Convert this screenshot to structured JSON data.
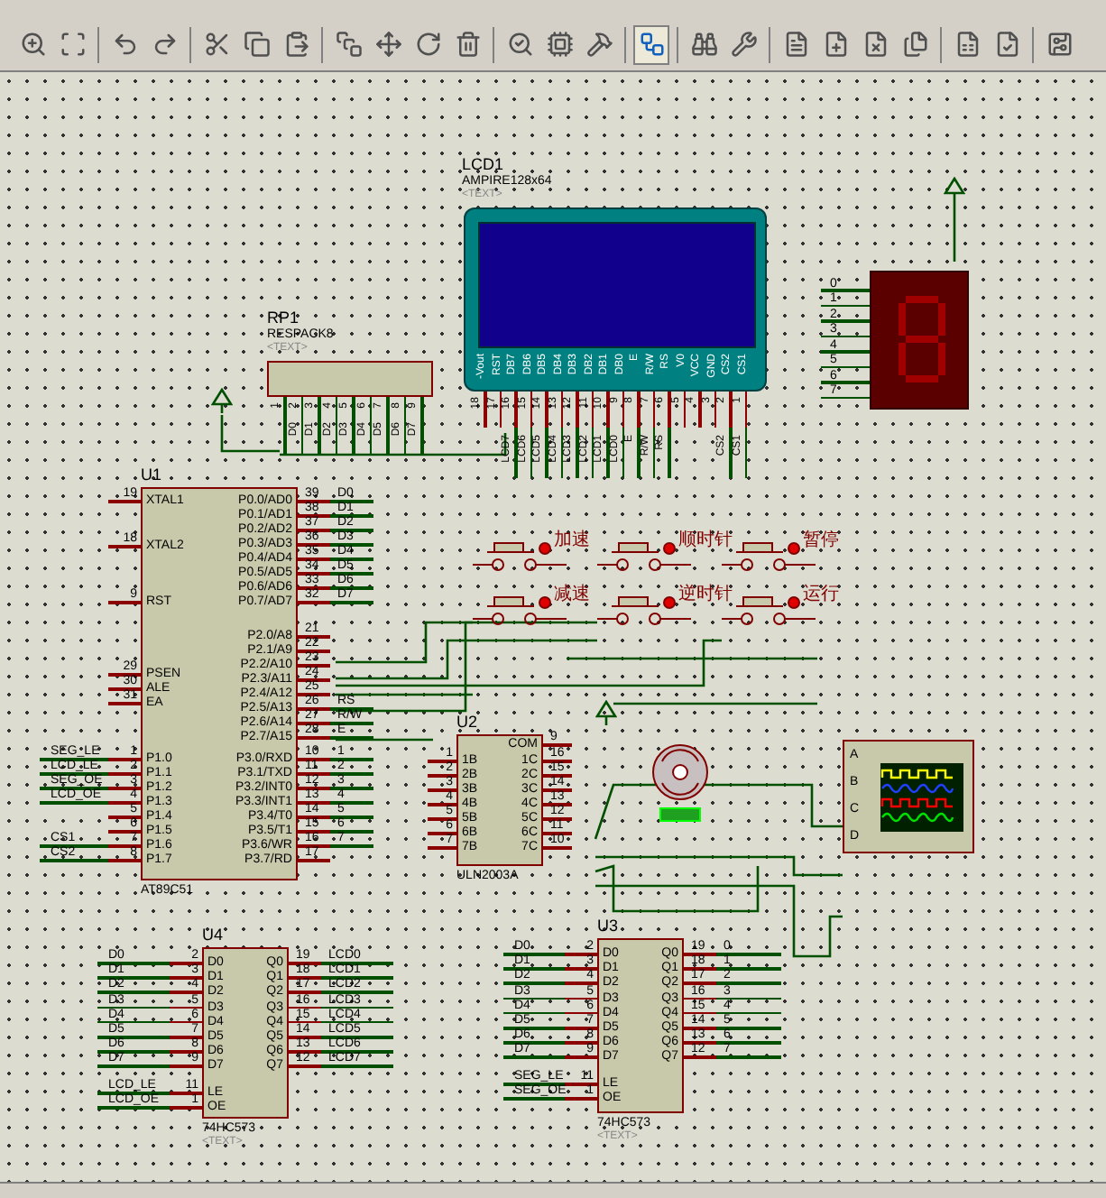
{
  "toolbar": {
    "tools": [
      {
        "kind": "zoom-in",
        "selected": false
      },
      {
        "kind": "zoom-area",
        "selected": false
      },
      {
        "kind": "undo",
        "selected": false
      },
      {
        "kind": "redo",
        "selected": false
      },
      {
        "kind": "cut",
        "selected": false
      },
      {
        "kind": "copy",
        "selected": false
      },
      {
        "kind": "paste",
        "selected": false
      },
      {
        "kind": "block-copy",
        "selected": false
      },
      {
        "kind": "block-move",
        "selected": false
      },
      {
        "kind": "block-rotate",
        "selected": false
      },
      {
        "kind": "block-delete",
        "selected": false
      },
      {
        "kind": "pick-device",
        "selected": false
      },
      {
        "kind": "make-device",
        "selected": false
      },
      {
        "kind": "decompose",
        "selected": false
      },
      {
        "kind": "autorouter",
        "selected": true
      },
      {
        "kind": "search",
        "selected": false
      },
      {
        "kind": "property",
        "selected": false
      },
      {
        "kind": "new-sheet",
        "selected": false
      },
      {
        "kind": "add-sheet",
        "selected": false
      },
      {
        "kind": "remove-sheet",
        "selected": false
      },
      {
        "kind": "goto-sheet",
        "selected": false
      },
      {
        "kind": "bom",
        "selected": false
      },
      {
        "kind": "erc",
        "selected": false
      },
      {
        "kind": "ares",
        "selected": false
      }
    ]
  },
  "schematic": {
    "lcd": {
      "ref": "LCD1",
      "part": "AMPIRE128x64",
      "text": "<TEXT>",
      "pins": [
        {
          "number": "18",
          "name": "-Vout"
        },
        {
          "number": "17",
          "name": "RST"
        },
        {
          "number": "16",
          "name": "DB7",
          "net": "LCD7"
        },
        {
          "number": "15",
          "name": "DB6",
          "net": "LCD6"
        },
        {
          "number": "14",
          "name": "DB5",
          "net": "LCD5"
        },
        {
          "number": "13",
          "name": "DB4",
          "net": "LCD4"
        },
        {
          "number": "12",
          "name": "DB3",
          "net": "LCD3"
        },
        {
          "number": "11",
          "name": "DB2",
          "net": "LCD2"
        },
        {
          "number": "10",
          "name": "DB1",
          "net": "LCD1"
        },
        {
          "number": "9",
          "name": "DB0",
          "net": "LCD0"
        },
        {
          "number": "8",
          "name": "E",
          "net": "E"
        },
        {
          "number": "7",
          "name": "R/W",
          "net": "R/W"
        },
        {
          "number": "6",
          "name": "RS",
          "net": "RS"
        },
        {
          "number": "5",
          "name": "V0"
        },
        {
          "number": "4",
          "name": "VCC"
        },
        {
          "number": "3",
          "name": "GND"
        },
        {
          "number": "2",
          "name": "CS2",
          "net": "CS2"
        },
        {
          "number": "1",
          "name": "CS1",
          "net": "CS1"
        }
      ]
    },
    "rp": {
      "ref": "RP1",
      "part": "RESPACK8",
      "text": "<TEXT>",
      "pins": [
        {
          "number": "1"
        },
        {
          "number": "2",
          "net": "D0"
        },
        {
          "number": "3",
          "net": "D1"
        },
        {
          "number": "4",
          "net": "D2"
        },
        {
          "number": "5",
          "net": "D3"
        },
        {
          "number": "6",
          "net": "D4"
        },
        {
          "number": "7",
          "net": "D5"
        },
        {
          "number": "8",
          "net": "D6"
        },
        {
          "number": "9",
          "net": "D7"
        }
      ]
    },
    "u1": {
      "ref": "U1",
      "part": "AT89C51",
      "left": [
        {
          "number": "19",
          "name": "XTAL1"
        },
        {
          "number": "18",
          "name": "XTAL2"
        },
        {
          "number": "9",
          "name": "RST"
        },
        {
          "number": "29",
          "name": "PSEN"
        },
        {
          "number": "30",
          "name": "ALE"
        },
        {
          "number": "31",
          "name": "EA"
        },
        {
          "number": "1",
          "name": "P1.0",
          "net": "SEG_LE"
        },
        {
          "number": "2",
          "name": "P1.1",
          "net": "LCD_LE"
        },
        {
          "number": "3",
          "name": "P1.2",
          "net": "SEG_OE"
        },
        {
          "number": "4",
          "name": "P1.3",
          "net": "LCD_OE"
        },
        {
          "number": "5",
          "name": "P1.4"
        },
        {
          "number": "6",
          "name": "P1.5"
        },
        {
          "number": "7",
          "name": "P1.6",
          "net": "CS1"
        },
        {
          "number": "8",
          "name": "P1.7",
          "net": "CS2"
        }
      ],
      "right": [
        {
          "number": "39",
          "name": "P0.0/AD0",
          "net": "D0"
        },
        {
          "number": "38",
          "name": "P0.1/AD1",
          "net": "D1"
        },
        {
          "number": "37",
          "name": "P0.2/AD2",
          "net": "D2"
        },
        {
          "number": "36",
          "name": "P0.3/AD3",
          "net": "D3"
        },
        {
          "number": "35",
          "name": "P0.4/AD4",
          "net": "D4"
        },
        {
          "number": "34",
          "name": "P0.5/AD5",
          "net": "D5"
        },
        {
          "number": "33",
          "name": "P0.6/AD6",
          "net": "D6"
        },
        {
          "number": "32",
          "name": "P0.7/AD7",
          "net": "D7"
        },
        {
          "number": "21",
          "name": "P2.0/A8"
        },
        {
          "number": "22",
          "name": "P2.1/A9"
        },
        {
          "number": "23",
          "name": "P2.2/A10"
        },
        {
          "number": "24",
          "name": "P2.3/A11"
        },
        {
          "number": "25",
          "name": "P2.4/A12"
        },
        {
          "number": "26",
          "name": "P2.5/A13",
          "net": "RS"
        },
        {
          "number": "27",
          "name": "P2.6/A14",
          "net": "R/W"
        },
        {
          "number": "28",
          "name": "P2.7/A15",
          "net": "E"
        },
        {
          "number": "10",
          "name": "P3.0/RXD",
          "net": "1"
        },
        {
          "number": "11",
          "name": "P3.1/TXD",
          "net": "2"
        },
        {
          "number": "12",
          "name": "P3.2/INT0",
          "net": "3"
        },
        {
          "number": "13",
          "name": "P3.3/INT1",
          "net": "4"
        },
        {
          "number": "14",
          "name": "P3.4/T0",
          "net": "5"
        },
        {
          "number": "15",
          "name": "P3.5/T1",
          "net": "6"
        },
        {
          "number": "16",
          "name": "P3.6/WR",
          "net": "7"
        },
        {
          "number": "17",
          "name": "P3.7/RD"
        }
      ]
    },
    "switches": [
      {
        "label": "加速"
      },
      {
        "label": "顺时针"
      },
      {
        "label": "暂停"
      },
      {
        "label": "减速"
      },
      {
        "label": "逆时针"
      },
      {
        "label": "运行"
      }
    ],
    "u2": {
      "ref": "U2",
      "part": "ULN2003A",
      "left": [
        {
          "number": "1",
          "name": "1B"
        },
        {
          "number": "2",
          "name": "2B"
        },
        {
          "number": "3",
          "name": "3B"
        },
        {
          "number": "4",
          "name": "4B"
        },
        {
          "number": "5",
          "name": "5B"
        },
        {
          "number": "6",
          "name": "6B"
        },
        {
          "number": "7",
          "name": "7B"
        }
      ],
      "right": [
        {
          "number": "9",
          "name": "COM"
        },
        {
          "number": "16",
          "name": "1C"
        },
        {
          "number": "15",
          "name": "2C"
        },
        {
          "number": "14",
          "name": "3C"
        },
        {
          "number": "13",
          "name": "4C"
        },
        {
          "number": "12",
          "name": "5C"
        },
        {
          "number": "11",
          "name": "6C"
        },
        {
          "number": "10",
          "name": "7C"
        }
      ]
    },
    "scope": {
      "channels": [
        "A",
        "B",
        "C",
        "D"
      ]
    },
    "display": {
      "nets": [
        "0",
        "1",
        "2",
        "3",
        "4",
        "5",
        "6",
        "7"
      ]
    },
    "u4": {
      "ref": "U4",
      "part": "74HC573",
      "text": "<TEXT>",
      "left": [
        {
          "number": "2",
          "name": "D0",
          "net": "D0"
        },
        {
          "number": "3",
          "name": "D1",
          "net": "D1"
        },
        {
          "number": "4",
          "name": "D2",
          "net": "D2"
        },
        {
          "number": "5",
          "name": "D3",
          "net": "D3"
        },
        {
          "number": "6",
          "name": "D4",
          "net": "D4"
        },
        {
          "number": "7",
          "name": "D5",
          "net": "D5"
        },
        {
          "number": "8",
          "name": "D6",
          "net": "D6"
        },
        {
          "number": "9",
          "name": "D7",
          "net": "D7"
        },
        {
          "number": "11",
          "name": "LE",
          "net": "LCD_LE"
        },
        {
          "number": "1",
          "name": "OE",
          "net": "LCD_OE"
        }
      ],
      "right": [
        {
          "number": "19",
          "name": "Q0",
          "net": "LCD0"
        },
        {
          "number": "18",
          "name": "Q1",
          "net": "LCD1"
        },
        {
          "number": "17",
          "name": "Q2",
          "net": "LCD2"
        },
        {
          "number": "16",
          "name": "Q3",
          "net": "LCD3"
        },
        {
          "number": "15",
          "name": "Q4",
          "net": "LCD4"
        },
        {
          "number": "14",
          "name": "Q5",
          "net": "LCD5"
        },
        {
          "number": "13",
          "name": "Q6",
          "net": "LCD6"
        },
        {
          "number": "12",
          "name": "Q7",
          "net": "LCD7"
        }
      ]
    },
    "u3": {
      "ref": "U3",
      "part": "74HC573",
      "text": "<TEXT>",
      "left": [
        {
          "number": "2",
          "name": "D0",
          "net": "D0"
        },
        {
          "number": "3",
          "name": "D1",
          "net": "D1"
        },
        {
          "number": "4",
          "name": "D2",
          "net": "D2"
        },
        {
          "number": "5",
          "name": "D3",
          "net": "D3"
        },
        {
          "number": "6",
          "name": "D4",
          "net": "D4"
        },
        {
          "number": "7",
          "name": "D5",
          "net": "D5"
        },
        {
          "number": "8",
          "name": "D6",
          "net": "D6"
        },
        {
          "number": "9",
          "name": "D7",
          "net": "D7"
        },
        {
          "number": "11",
          "name": "LE",
          "net": "SEG_LE"
        },
        {
          "number": "1",
          "name": "OE",
          "net": "SEG_OE"
        }
      ],
      "right": [
        {
          "number": "19",
          "name": "Q0",
          "net": "0"
        },
        {
          "number": "18",
          "name": "Q1",
          "net": "1"
        },
        {
          "number": "17",
          "name": "Q2",
          "net": "2"
        },
        {
          "number": "16",
          "name": "Q3",
          "net": "3"
        },
        {
          "number": "15",
          "name": "Q4",
          "net": "4"
        },
        {
          "number": "14",
          "name": "Q5",
          "net": "5"
        },
        {
          "number": "13",
          "name": "Q6",
          "net": "6"
        },
        {
          "number": "12",
          "name": "Q7",
          "net": "7"
        }
      ]
    }
  }
}
